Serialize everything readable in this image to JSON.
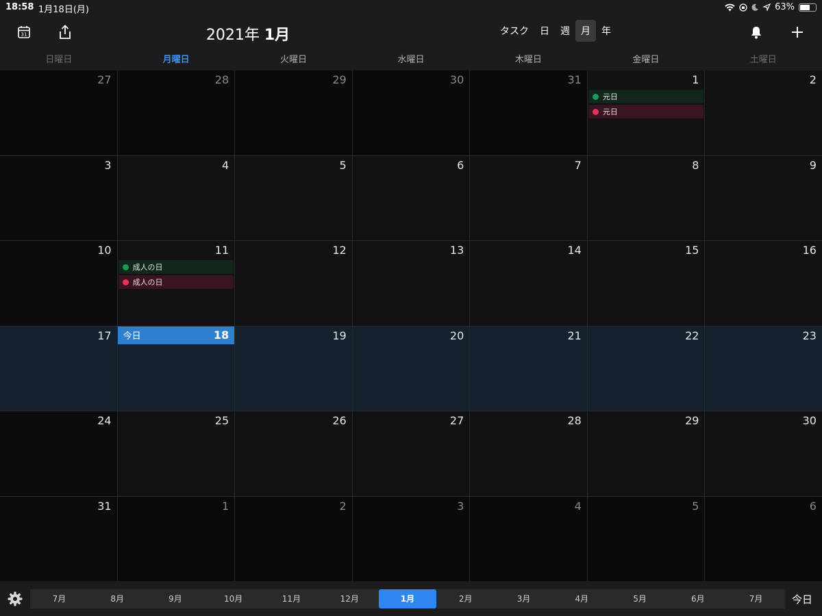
{
  "status": {
    "time": "18:58",
    "date": "1月18日(月)",
    "battery": "63%",
    "battery_level": 0.63
  },
  "header": {
    "year": "2021年",
    "month": "1月",
    "views": [
      "タスク",
      "日",
      "週",
      "月",
      "年"
    ],
    "active_view": 3
  },
  "weekdays": [
    "日曜日",
    "月曜日",
    "火曜日",
    "水曜日",
    "木曜日",
    "金曜日",
    "土曜日"
  ],
  "today_label": "今日",
  "weeks": [
    [
      {
        "d": "27",
        "o": true
      },
      {
        "d": "28",
        "o": true
      },
      {
        "d": "29",
        "o": true
      },
      {
        "d": "30",
        "o": true
      },
      {
        "d": "31",
        "o": true
      },
      {
        "d": "1",
        "events": [
          {
            "label": "元日",
            "color": "green"
          },
          {
            "label": "元日",
            "color": "red"
          }
        ]
      },
      {
        "d": "2"
      }
    ],
    [
      {
        "d": "3"
      },
      {
        "d": "4"
      },
      {
        "d": "5"
      },
      {
        "d": "6"
      },
      {
        "d": "7"
      },
      {
        "d": "8"
      },
      {
        "d": "9"
      }
    ],
    [
      {
        "d": "10"
      },
      {
        "d": "11",
        "events": [
          {
            "label": "成人の日",
            "color": "green"
          },
          {
            "label": "成人の日",
            "color": "red"
          }
        ]
      },
      {
        "d": "12"
      },
      {
        "d": "13"
      },
      {
        "d": "14"
      },
      {
        "d": "15"
      },
      {
        "d": "16"
      }
    ],
    [
      {
        "d": "17"
      },
      {
        "d": "18",
        "today": true
      },
      {
        "d": "19"
      },
      {
        "d": "20"
      },
      {
        "d": "21"
      },
      {
        "d": "22"
      },
      {
        "d": "23"
      }
    ],
    [
      {
        "d": "24"
      },
      {
        "d": "25"
      },
      {
        "d": "26"
      },
      {
        "d": "27"
      },
      {
        "d": "28"
      },
      {
        "d": "29"
      },
      {
        "d": "30"
      }
    ],
    [
      {
        "d": "31"
      },
      {
        "d": "1",
        "o": true
      },
      {
        "d": "2",
        "o": true
      },
      {
        "d": "3",
        "o": true
      },
      {
        "d": "4",
        "o": true
      },
      {
        "d": "5",
        "o": true
      },
      {
        "d": "6",
        "o": true
      }
    ]
  ],
  "today_week": 3,
  "months": [
    "7月",
    "8月",
    "9月",
    "10月",
    "11月",
    "12月",
    "1月",
    "2月",
    "3月",
    "4月",
    "5月",
    "6月",
    "7月"
  ],
  "active_month": 6,
  "bottom": {
    "today_button": "今日"
  },
  "colors": {
    "accent": "#2f88f0",
    "today_bar": "#2f7fd0",
    "holiday_green": "#1a9a57",
    "holiday_red": "#e6325b"
  }
}
